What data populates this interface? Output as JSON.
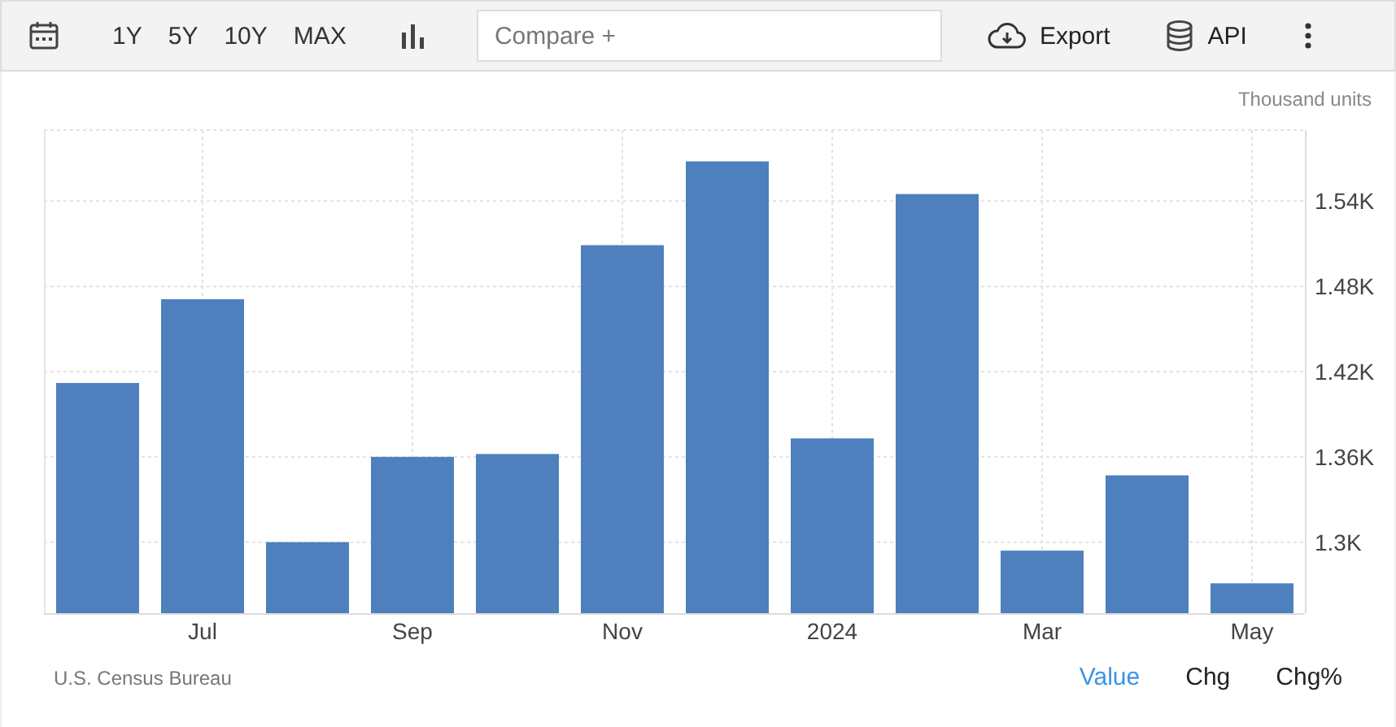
{
  "toolbar": {
    "ranges": [
      {
        "label": "1Y"
      },
      {
        "label": "5Y"
      },
      {
        "label": "10Y"
      },
      {
        "label": "MAX"
      }
    ],
    "compare": {
      "placeholder": "Compare +"
    },
    "export": {
      "label": "Export"
    },
    "api": {
      "label": "API"
    }
  },
  "unit": "Thousand units",
  "chart": {
    "chart_data": {
      "type": "bar",
      "grid": true,
      "categories": [
        null,
        "Jul",
        null,
        "Sep",
        null,
        "Nov",
        null,
        "2024",
        null,
        "Mar",
        null,
        "May"
      ],
      "series": [
        {
          "color": "#4d80bd",
          "values": [
            1.412,
            1.471,
            1.3,
            1.36,
            1.362,
            1.509,
            1.568,
            1.373,
            1.545,
            1.294,
            1.347,
            1.271
          ]
        }
      ],
      "ylim": [
        1.25,
        1.59
      ],
      "yticks": [
        {
          "value": 1.3,
          "label": "1.3K"
        },
        {
          "value": 1.36,
          "label": "1.36K"
        },
        {
          "value": 1.42,
          "label": "1.42K"
        },
        {
          "value": 1.48,
          "label": "1.48K"
        },
        {
          "value": 1.54,
          "label": "1.54K"
        }
      ]
    }
  },
  "source": "U.S. Census Bureau",
  "modes": [
    {
      "label": "Value",
      "selected": true
    },
    {
      "label": "Chg",
      "selected": false
    },
    {
      "label": "Chg%",
      "selected": false
    }
  ]
}
